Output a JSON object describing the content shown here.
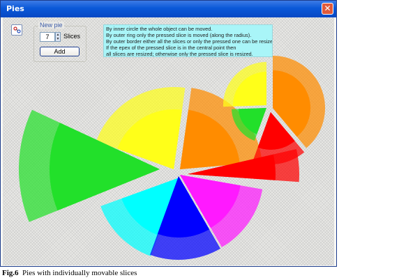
{
  "window": {
    "title": "Pies",
    "close_symbol": "✕"
  },
  "toolbar": {
    "tool_icon": "pie-tool-icon"
  },
  "new_pie": {
    "group_label": "New pie",
    "slices_value": "7",
    "slices_label": "Slices",
    "add_label": "Add"
  },
  "info": {
    "lines": [
      "By inner circle the whole object can be moved.",
      "By outer ring only the pressed slice is moved (along the radius).",
      "By outer border either all the slices or only the pressed one can be resized.",
      "If the epex of the pressed slice is in the central point then",
      "all slices are resized; otherwise only the pressed slice is resized."
    ]
  },
  "caption": {
    "fig_label": "Fig.6",
    "text": "Pies with individually movable slices"
  },
  "colors": {
    "green": "#22e02a",
    "yellow": "#ffff19",
    "orange": "#ff8c00",
    "red": "#ff0000",
    "cyan": "#00ffff",
    "blue": "#0000ff",
    "magenta": "#ff19ff"
  }
}
